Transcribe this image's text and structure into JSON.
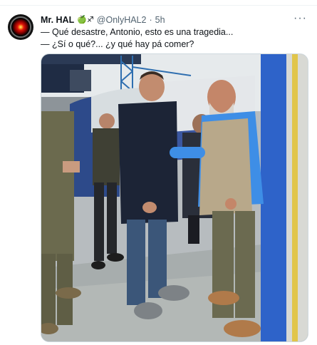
{
  "tweet": {
    "author_name": "Mr. HAL",
    "author_badge": "🍏♐",
    "handle": "@OnlyHAL2",
    "separator": "·",
    "time": "5h",
    "more_glyph": "···",
    "lines": [
      "— Qué desastre, Antonio, esto es una tragedia...",
      "— ¿Sí o qué?... ¿y qué hay pá comer?"
    ]
  },
  "avatar_icon": "hal-9000-eye-icon",
  "media": {
    "description_icon": "photo-icon"
  }
}
